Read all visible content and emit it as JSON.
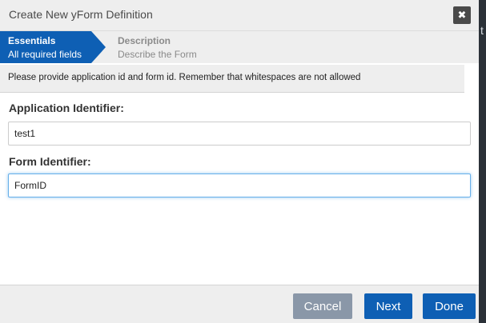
{
  "dialog": {
    "title": "Create New yForm Definition",
    "close_label": "✖"
  },
  "background": {
    "edge_letter": "t"
  },
  "steps": [
    {
      "title": "Essentials",
      "subtitle": "All required fields",
      "active": true
    },
    {
      "title": "Description",
      "subtitle": "Describe the Form",
      "active": false
    }
  ],
  "info": {
    "message": "Please provide application id and form id. Remember that whitespaces are not allowed"
  },
  "form": {
    "app_id_label": "Application Identifier:",
    "app_id_value": "test1",
    "form_id_label": "Form Identifier:",
    "form_id_value": "FormID"
  },
  "buttons": {
    "cancel": "Cancel",
    "next": "Next",
    "done": "Done"
  },
  "colors": {
    "accent": "#0e5fb4",
    "cancel": "#8a97a8",
    "panel": "#eeeeee"
  }
}
